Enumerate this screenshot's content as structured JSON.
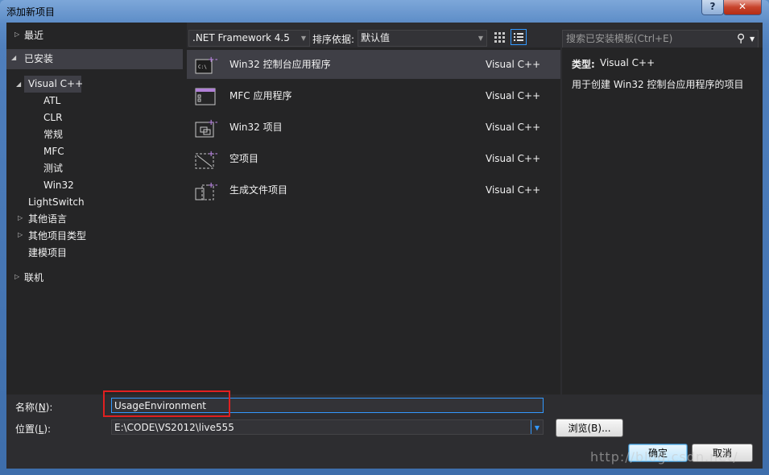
{
  "window": {
    "title": "添加新项目",
    "help": "?",
    "close": "✕"
  },
  "tree": {
    "recent": "最近",
    "installed": "已安装",
    "visual_cpp": "Visual C++",
    "children": [
      "ATL",
      "CLR",
      "常规",
      "MFC",
      "测试",
      "Win32"
    ],
    "lightswitch": "LightSwitch",
    "other_languages": "其他语言",
    "other_project_types": "其他项目类型",
    "modeling": "建模项目",
    "online": "联机"
  },
  "toolbar": {
    "framework": ".NET Framework 4.5",
    "sort_label": "排序依据:",
    "sort_value": "默认值",
    "search_placeholder": "搜索已安装模板(Ctrl+E)"
  },
  "templates": [
    {
      "name": "Win32 控制台应用程序",
      "lang": "Visual C++",
      "icon": "console-app-icon"
    },
    {
      "name": "MFC 应用程序",
      "lang": "Visual C++",
      "icon": "mfc-app-icon"
    },
    {
      "name": "Win32 项目",
      "lang": "Visual C++",
      "icon": "win32-project-icon"
    },
    {
      "name": "空项目",
      "lang": "Visual C++",
      "icon": "empty-project-icon"
    },
    {
      "name": "生成文件项目",
      "lang": "Visual C++",
      "icon": "makefile-project-icon"
    }
  ],
  "details": {
    "type_label": "类型:",
    "type_value": "Visual C++",
    "description": "用于创建 Win32 控制台应用程序的项目"
  },
  "form": {
    "name_label": "名称(",
    "name_key": "N",
    "name_suffix": "):",
    "name_value": "UsageEnvironment",
    "location_label": "位置(",
    "location_key": "L",
    "location_suffix": "):",
    "location_value": "E:\\CODE\\VS2012\\live555",
    "browse": "浏览(B)...",
    "ok": "确定",
    "cancel": "取消"
  },
  "watermark": "http://blog.csdn.net/"
}
